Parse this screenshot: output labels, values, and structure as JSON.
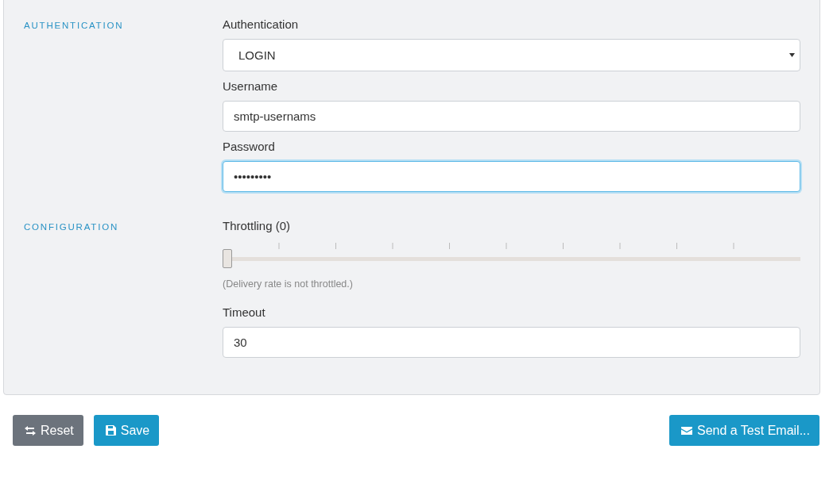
{
  "sections": [
    {
      "heading": "AUTHENTICATION",
      "fields": [
        {
          "kind": "select",
          "label": "Authentication",
          "value": "LOGIN",
          "focused": false
        },
        {
          "kind": "text",
          "label": "Username",
          "value": "smtp-usernams",
          "focused": false
        },
        {
          "kind": "text",
          "label": "Password",
          "value": "•••••••••",
          "focused": true
        }
      ]
    },
    {
      "heading": "CONFIGURATION",
      "fields": [
        {
          "kind": "slider",
          "label": "Throttling (0)",
          "level": 0,
          "hint": "(Delivery rate is not throttled.)"
        },
        {
          "kind": "text",
          "label": "Timeout",
          "value": "30",
          "focused": false
        }
      ]
    }
  ],
  "buttons": [
    {
      "label": "Reset",
      "kind": "reset"
    },
    {
      "label": "Save",
      "kind": "save"
    },
    {
      "label": "Send a Test Email...",
      "kind": "email"
    }
  ]
}
